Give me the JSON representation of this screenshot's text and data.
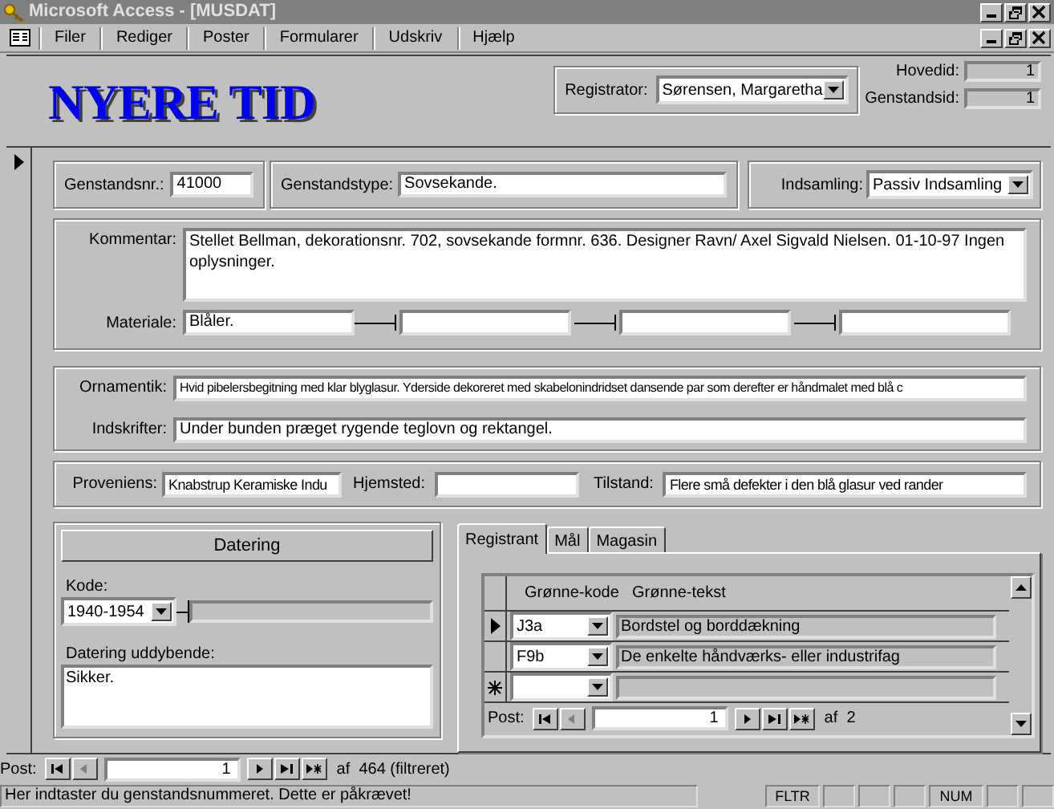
{
  "window": {
    "title": "Microsoft Access - [MUSDAT]"
  },
  "menu": [
    {
      "label": "Filer"
    },
    {
      "label": "Rediger"
    },
    {
      "label": "Poster"
    },
    {
      "label": "Formularer"
    },
    {
      "label": "Udskriv"
    },
    {
      "label": "Hjælp"
    }
  ],
  "header": {
    "title": "NYERE TID",
    "registrator": {
      "label": "Registrator:",
      "value": "Sørensen, Margaretha"
    },
    "ids": [
      {
        "label": "Hovedid:",
        "value": "1"
      },
      {
        "label": "Genstandsid:",
        "value": "1"
      }
    ]
  },
  "row1": {
    "genstandsnr": {
      "label": "Genstandsnr.:",
      "value": "41000"
    },
    "genstandstype": {
      "label": "Genstandstype:",
      "value": "Sovsekande."
    },
    "indsamling": {
      "label": "Indsamling:",
      "value": "Passiv Indsamling"
    }
  },
  "kommentar": {
    "label": "Kommentar:",
    "value": "Stellet Bellman, dekorationsnr. 702, sovsekande formnr. 636. Designer Ravn/ Axel Sigvald Nielsen. 01-10-97 Ingen oplysninger."
  },
  "materiale": {
    "label": "Materiale:",
    "value": "Blåler."
  },
  "ornamentik": {
    "label": "Ornamentik:",
    "value": "Hvid pibelersbegitning med klar blyglasur. Yderside dekoreret med skabelonindridset dansende par som derefter er håndmalet med blå c"
  },
  "indskrifter": {
    "label": "Indskrifter:",
    "value": "Under bunden præget rygende teglovn og rektangel."
  },
  "proveniens": {
    "label": "Proveniens:",
    "value": "Knabstrup Keramiske Indu"
  },
  "hjemsted": {
    "label": "Hjemsted:"
  },
  "tilstand": {
    "label": "Tilstand:",
    "value": "Flere små defekter i den blå glasur ved rander"
  },
  "datering": {
    "button": "Datering",
    "kode_label": "Kode:",
    "kode_value": "1940-1954",
    "uddybende_label": "Datering uddybende:",
    "uddybende_value": "Sikker."
  },
  "tabs": [
    {
      "label": "Registrant",
      "selected": true
    },
    {
      "label": "Mål",
      "selected": false
    },
    {
      "label": "Magasin",
      "selected": false
    }
  ],
  "subform": {
    "columns": [
      "Grønne-kode",
      "Grønne-tekst"
    ],
    "rows": [
      {
        "kind": "record",
        "current": true,
        "code": "J3a",
        "text": "Bordstel og borddækning"
      },
      {
        "kind": "record",
        "current": false,
        "code": "F9b",
        "text": "De enkelte håndværks- eller industrifag"
      },
      {
        "kind": "new",
        "current": false
      }
    ],
    "nav": {
      "label": "Post:",
      "record": "1",
      "of": "af  2"
    }
  },
  "nav": {
    "label": "Post:",
    "record": "1",
    "of": "af  464 (filtreret)"
  },
  "status_bar": {
    "message": "Her indtaster du genstandsnummeret. Dette er påkrævet!",
    "indicators": [
      {
        "kind": "text",
        "label": "FLTR"
      },
      {
        "kind": "blank"
      },
      {
        "kind": "blank"
      },
      {
        "kind": "blank"
      },
      {
        "kind": "text",
        "label": "NUM"
      },
      {
        "kind": "blank"
      },
      {
        "kind": "blank"
      }
    ]
  }
}
